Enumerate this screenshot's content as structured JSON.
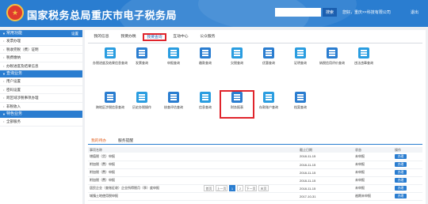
{
  "header": {
    "title": "国家税务总局重庆市电子税务局",
    "search_placeholder": "",
    "search_button": "搜索",
    "user": "您好，重庆××科技有限公司",
    "logout": "退出"
  },
  "sidebar": {
    "sections": [
      {
        "title": "常用功能",
        "more": "设置",
        "items": [
          "发票办理",
          "税收完税（费）证明",
          "税费缴纳",
          "办税进度及结果信息"
        ]
      },
      {
        "title": "查询业务",
        "items": [
          "用户设置",
          "密码设置",
          "跨区域涉税事项办理",
          "非税收入"
        ]
      },
      {
        "title": "特色业务",
        "items": [
          "全部服务"
        ]
      }
    ]
  },
  "tabs": [
    "我的信息",
    "我要办税",
    "我要查询",
    "互动中心",
    "公众服务"
  ],
  "active_tab": "我要查询",
  "tiles": [
    {
      "label": "办税进度及结果信息查询",
      "color": "#2a9de0"
    },
    {
      "label": "发票查询",
      "color": "#2a7dd0"
    },
    {
      "label": "申报查询",
      "color": "#2a9de0"
    },
    {
      "label": "缴款查询",
      "color": "#2a7dd0"
    },
    {
      "label": "欠税查询",
      "color": "#2a9de0"
    },
    {
      "label": "优惠查询",
      "color": "#2a7dd0"
    },
    {
      "label": "证明查询",
      "color": "#2a9de0"
    },
    {
      "label": "纳税信用评价查询",
      "color": "#2a7dd0"
    },
    {
      "label": "违法违章查询",
      "color": "#2a9de0"
    },
    {
      "label": "跨地区涉税信息查询",
      "color": "#2a7dd0"
    },
    {
      "label": "历史办税操作",
      "color": "#2a9de0"
    },
    {
      "label": "核查评估查询",
      "color": "#2a7dd0"
    },
    {
      "label": "信息查询",
      "color": "#2a9de0"
    },
    {
      "label": "财务报表",
      "color": "#2a7dd0"
    },
    {
      "label": "存款账户查询",
      "color": "#2a9de0"
    },
    {
      "label": "档案查询",
      "color": "#2a7dd0"
    }
  ],
  "lower_tabs": [
    "我的待办",
    "服务提醒"
  ],
  "table": {
    "headers": [
      "事项名称",
      "截止日期",
      "状态",
      "操作"
    ],
    "rows": [
      {
        "name": "增值税（货）申报",
        "date": "2018-11-15",
        "status": "未申报",
        "action": "办理"
      },
      {
        "name": "附加税（费）申报",
        "date": "2018-11-15",
        "status": "未申报",
        "action": "办理"
      },
      {
        "name": "附加税（费）申报",
        "date": "2018-11-15",
        "status": "未申报",
        "action": "办理"
      },
      {
        "name": "附加税（费）申报",
        "date": "2018-11-15",
        "status": "未申报",
        "action": "办理"
      },
      {
        "name": "居民企业（查账征收）企业所得税月（季）度申报",
        "date": "2018-11-15",
        "status": "未申报",
        "action": "办理"
      },
      {
        "name": "城镇土地使用税申报",
        "date": "2017-10-31",
        "status": "逾期未申报",
        "action": "办理"
      }
    ]
  },
  "pager": {
    "first": "首页",
    "prev": "上一页",
    "pages": [
      "1",
      "2"
    ],
    "next": "下一页",
    "last": "末页"
  }
}
